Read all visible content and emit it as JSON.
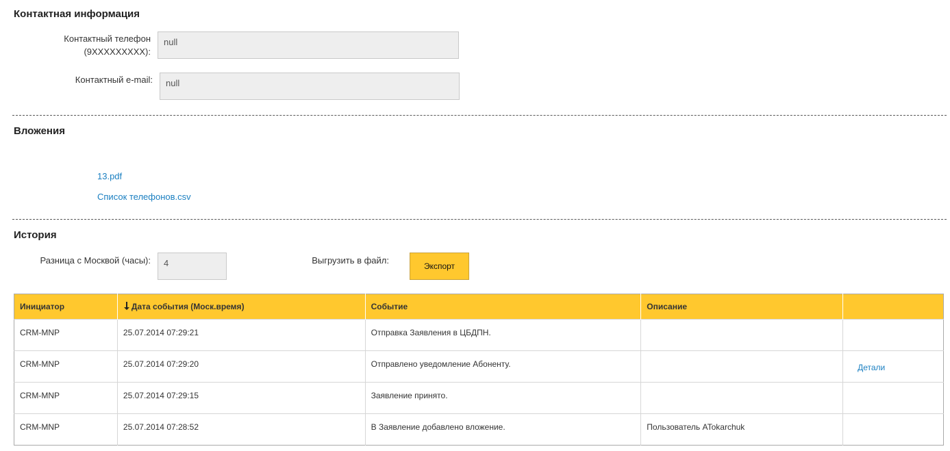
{
  "contacts": {
    "title": "Контактная информация",
    "phone_label_line1": "Контактный телефон",
    "phone_label_line2": "(9XXXXXXXXX):",
    "phone_value": "null",
    "email_label": "Контактный e-mail:",
    "email_value": "null"
  },
  "attachments": {
    "title": "Вложения",
    "files": [
      "13.pdf",
      "Список телефонов.csv"
    ]
  },
  "history": {
    "title": "История",
    "tz_label": "Разница с Москвой (часы):",
    "tz_value": "4",
    "export_label": "Выгрузить в файл:",
    "export_button": "Экспорт",
    "columns": [
      "Инициатор",
      "Дата события (Моск.время)",
      "Событие",
      "Описание",
      ""
    ],
    "rows": [
      {
        "initiator": "CRM-MNP",
        "date": "25.07.2014 07:29:21",
        "event": "Отправка Заявления в ЦБДПН.",
        "description": "",
        "details": ""
      },
      {
        "initiator": "CRM-MNP",
        "date": "25.07.2014 07:29:20",
        "event": "Отправлено уведомление Абоненту.",
        "description": "",
        "details": "Детали"
      },
      {
        "initiator": "CRM-MNP",
        "date": "25.07.2014 07:29:15",
        "event": "Заявление принято.",
        "description": "",
        "details": ""
      },
      {
        "initiator": "CRM-MNP",
        "date": "25.07.2014 07:28:52",
        "event": "В Заявление добавлено вложение.",
        "description": "Пользователь ATokarchuk",
        "details": ""
      }
    ]
  },
  "icons": {
    "sort": "arrow-down-icon"
  },
  "colors": {
    "accent": "#ffc82e",
    "link": "#1a7fc1",
    "field_bg": "#eeeeee"
  }
}
